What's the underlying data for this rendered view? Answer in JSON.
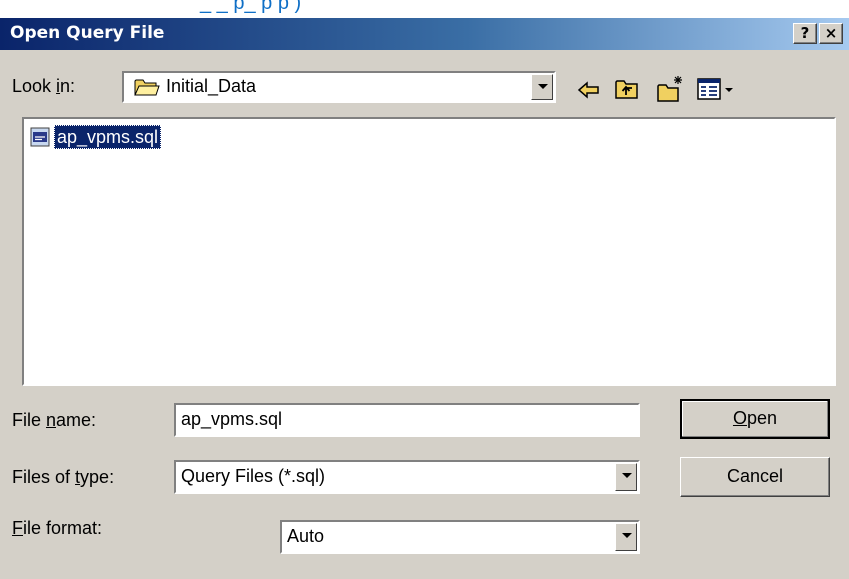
{
  "background_link": {
    "text": "_                    _           p_ p      p )"
  },
  "dialog": {
    "title": "Open Query File",
    "help_button": "?",
    "close_button": "×"
  },
  "look_in": {
    "label_pre": "Look ",
    "label_accel": "i",
    "label_post": "n:",
    "value": "Initial_Data"
  },
  "files": [
    {
      "name": "ap_vpms.sql",
      "selected": true
    }
  ],
  "file_name": {
    "label_pre": "File ",
    "label_accel": "n",
    "label_post": "ame:",
    "value": "ap_vpms.sql"
  },
  "files_of_type": {
    "label_pre": "Files of ",
    "label_accel": "t",
    "label_post": "ype:",
    "value": "Query Files (*.sql)"
  },
  "file_format": {
    "label_accel": "F",
    "label_post": "ile format:",
    "value": "Auto"
  },
  "buttons": {
    "open_accel": "O",
    "open_rest": "pen",
    "cancel": "Cancel"
  },
  "colors": {
    "title_start": "#0a246a",
    "title_end": "#a6caf0",
    "dialog_face": "#d4d0c8",
    "selection": "#0a246a",
    "link": "#0f6fc6"
  },
  "icons": [
    "folder-icon",
    "back-arrow-icon",
    "up-folder-icon",
    "new-folder-icon",
    "view-menu-icon",
    "sql-file-icon"
  ]
}
